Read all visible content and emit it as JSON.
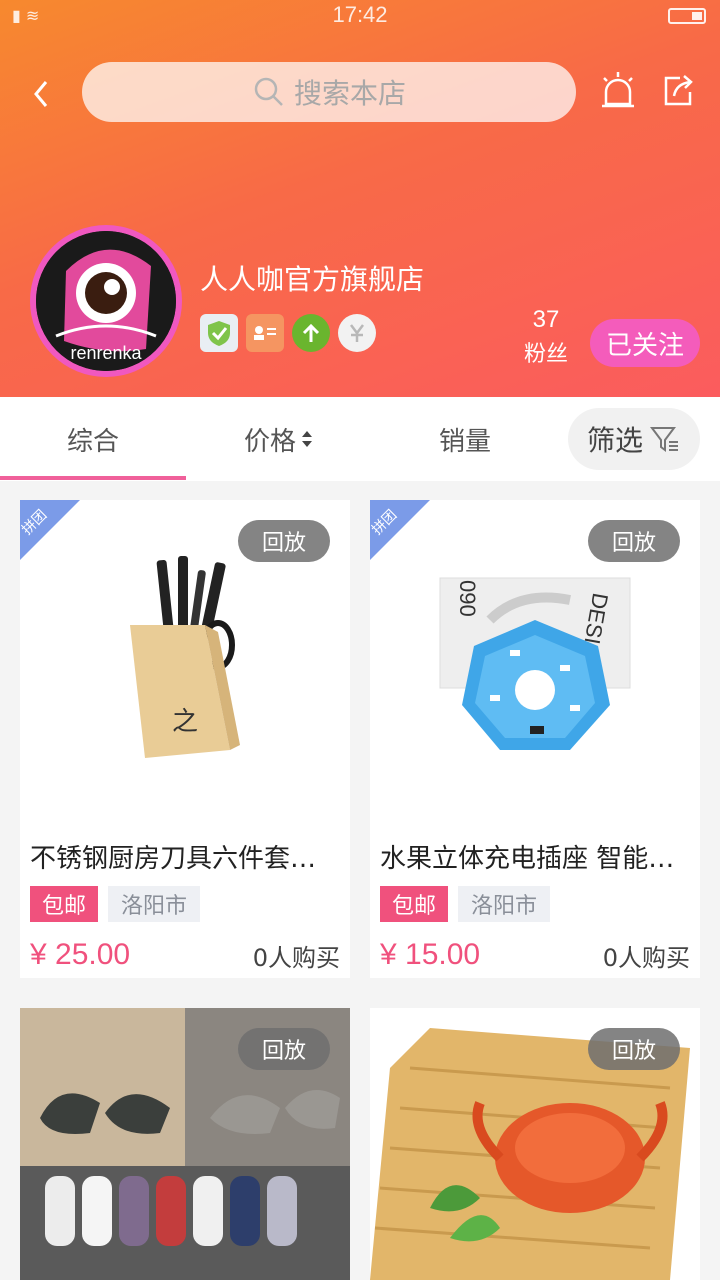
{
  "status_bar": {
    "time": "17:42"
  },
  "header": {
    "search_placeholder": "搜索本店",
    "store_name": "人人咖官方旗舰店",
    "avatar_text": "renrenka",
    "fans_count": "37",
    "fans_label": "粉丝",
    "follow_label": "已关注",
    "badges": [
      "verified-shield-icon",
      "id-card-icon",
      "up-arrow-icon",
      "yuan-icon"
    ]
  },
  "tabs": [
    {
      "label": "综合",
      "active": true
    },
    {
      "label": "价格",
      "active": false
    },
    {
      "label": "销量",
      "active": false
    }
  ],
  "filter_label": "筛选",
  "products": [
    {
      "ribbon": "拼团",
      "replay": "回放",
      "title": "不锈钢厨房刀具六件套…",
      "tag_free": "包邮",
      "tag_city": "洛阳市",
      "price": "¥ 25.00",
      "buyers": "0人购买",
      "image": "knife-block-set"
    },
    {
      "ribbon": "拼团",
      "replay": "回放",
      "title": "水果立体充电插座 智能…",
      "tag_free": "包邮",
      "tag_city": "洛阳市",
      "price": "¥ 15.00",
      "buyers": "0人购买",
      "image": "hexagon-power-strip"
    },
    {
      "replay": "回放",
      "image": "socks-collage"
    },
    {
      "replay": "回放",
      "image": "crab-on-bamboo-tray"
    }
  ],
  "colors": {
    "accent": "#f0517d",
    "follow": "#f45cbb",
    "header_start": "#f7892e",
    "header_end": "#fb5c5e"
  }
}
